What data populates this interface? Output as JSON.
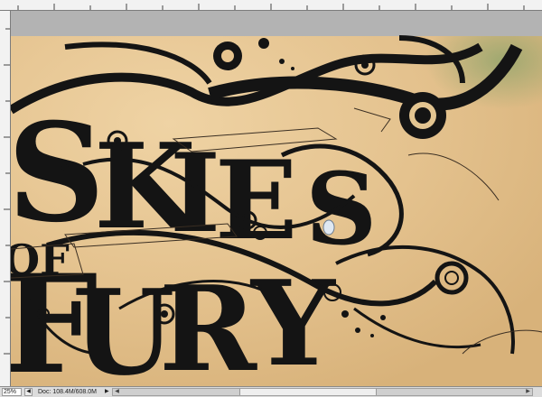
{
  "status_bar": {
    "zoom": "25%",
    "doc_info": "Doc: 108.4M/608.0M",
    "nav_icon": "left-nav-icon",
    "menu_icon": "triangle-right-icon"
  },
  "artwork": {
    "words": [
      "S",
      "K",
      "I",
      "E",
      "S",
      "O",
      "F",
      "F",
      "U",
      "R",
      "Y"
    ],
    "paper_color": "#e8c99a",
    "ink_color": "#141414"
  }
}
